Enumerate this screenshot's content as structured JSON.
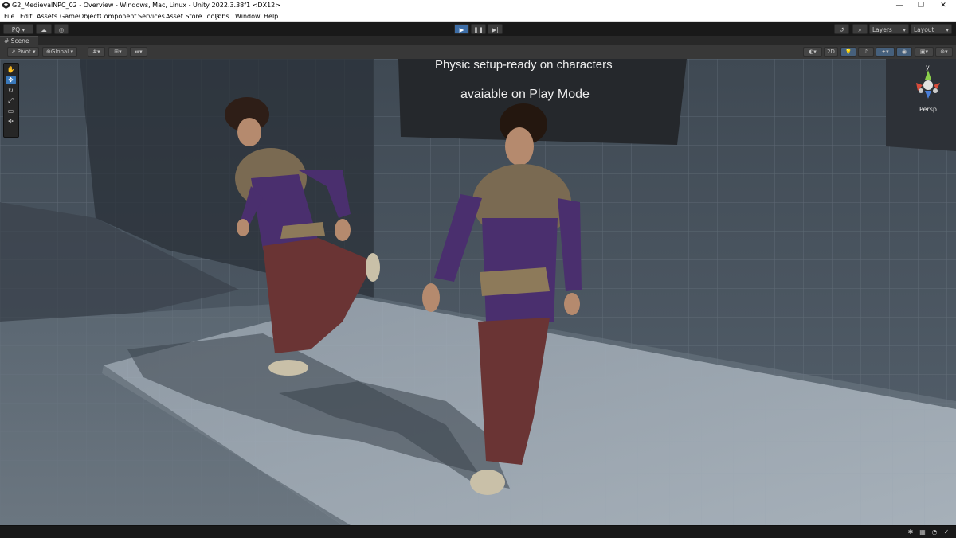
{
  "window": {
    "title": "G2_MedievalNPC_02 - Overview - Windows, Mac, Linux - Unity 2022.3.38f1 <DX12>",
    "minimize": "—",
    "restore": "❐",
    "close": "✕"
  },
  "menu": [
    "File",
    "Edit",
    "Assets",
    "GameObject",
    "Component",
    "Services",
    "Asset Store Tools",
    "Jobs",
    "Window",
    "Help"
  ],
  "toolbar": {
    "account": "PQ",
    "play": "▶",
    "pause": "❚❚",
    "step": "▶|",
    "layers": "Layers",
    "layout": "Layout"
  },
  "scene_tab": {
    "label": "Scene"
  },
  "scene_toolbar": {
    "pivot": "Pivot",
    "global": "Global",
    "mode_2d": "2D"
  },
  "scene_view": {
    "sign_line_1": "Physic setup-ready on characters",
    "sign_line_2": "avaiable on Play Mode",
    "gizmo_axis": "y",
    "projection": "Persp"
  },
  "colors": {
    "play_accent": "#3d6da6",
    "active_tool": "#3a79bb",
    "gizmo_y": "#8bd04b",
    "gizmo_x": "#d94b3b",
    "gizmo_z": "#4a7fd9",
    "dress_purple": "#4a2f6e",
    "skirt_maroon": "#6a3434",
    "fur": "#7a6a52"
  },
  "icons": [
    "hand-tool-icon",
    "move-tool-icon",
    "rotate-tool-icon",
    "scale-tool-icon",
    "rect-tool-icon",
    "transform-tool-icon",
    "history-icon",
    "search-icon",
    "cloud-icon",
    "settings-icon",
    "lighting-icon",
    "audio-icon",
    "effects-icon",
    "visibility-icon",
    "camera-icon",
    "gizmos-icon"
  ]
}
